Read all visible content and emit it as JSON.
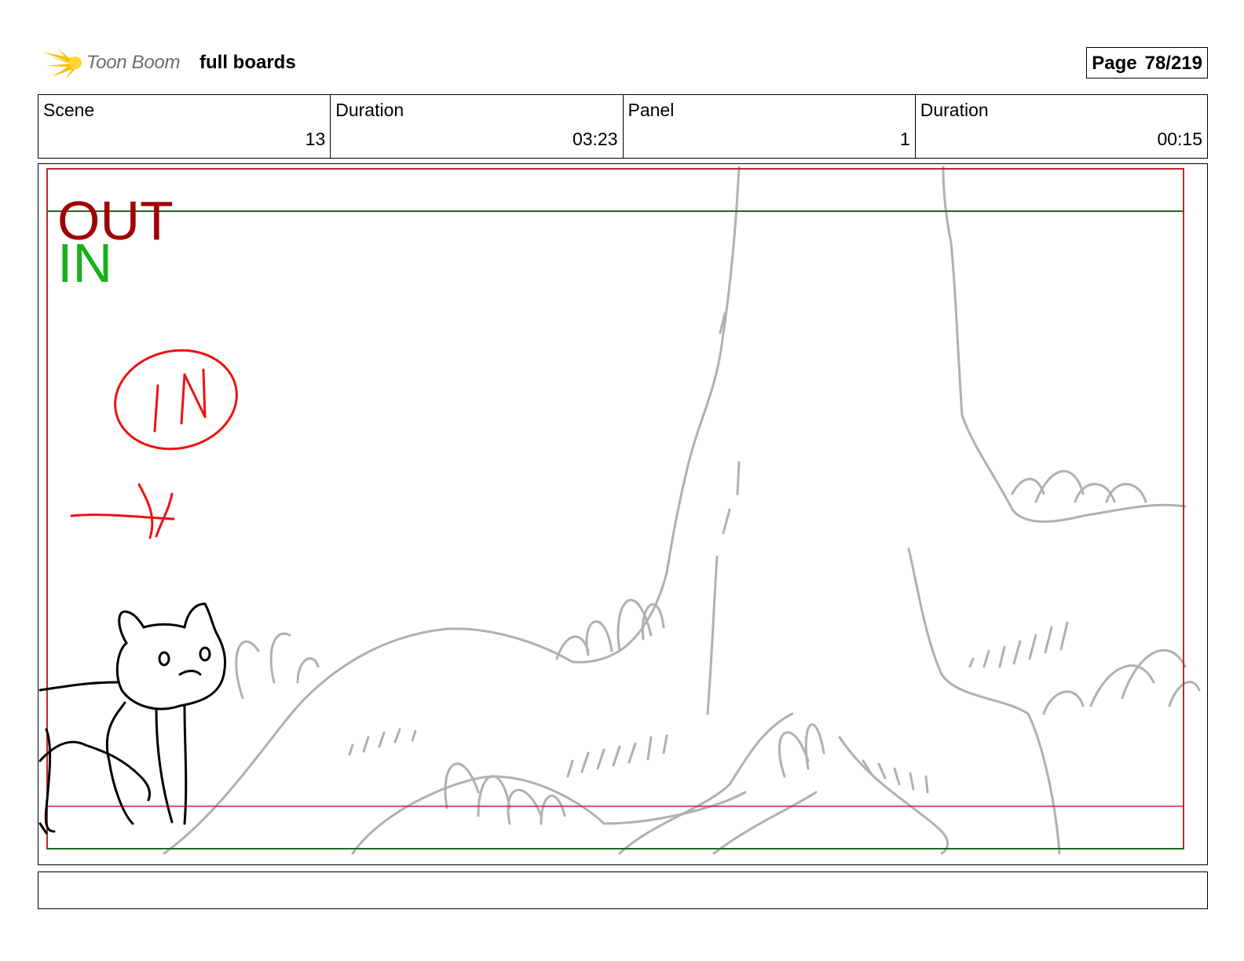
{
  "header": {
    "logo_text": "Toon Boom",
    "project_title": "full boards",
    "page_label": "Page",
    "page_number": "78/219"
  },
  "info": {
    "scene_label": "Scene",
    "scene_value": "13",
    "scene_duration_label": "Duration",
    "scene_duration_value": "03:23",
    "panel_label": "Panel",
    "panel_value": "1",
    "panel_duration_label": "Duration",
    "panel_duration_value": "00:15"
  },
  "panel": {
    "out_label": "OUT",
    "in_label": "IN",
    "out_color": "#a00000",
    "in_color": "#16b01a",
    "annotation_color": "#ee1111",
    "sketch_color": "#b0b0b0"
  },
  "caption": {
    "text": ""
  }
}
